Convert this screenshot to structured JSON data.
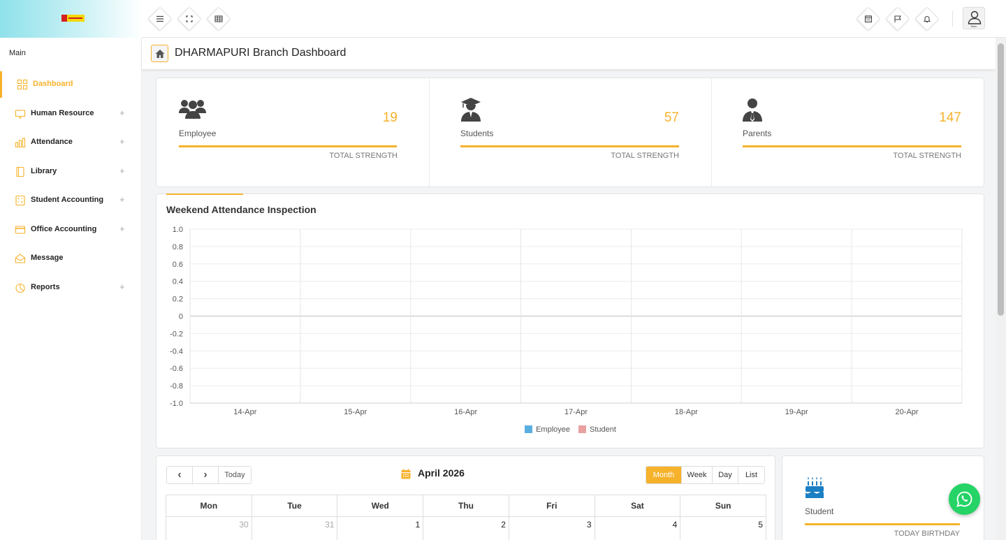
{
  "header": {
    "icons": [
      "menu-icon",
      "fullscreen-icon",
      "grid-icon",
      "calendar-icon",
      "flag-icon",
      "bell-icon",
      "user-icon"
    ],
    "avatar_caption": "Main"
  },
  "sidebar": {
    "section": "Main",
    "items": [
      {
        "label": "Dashboard",
        "icon": "dashboard-icon",
        "expandable": false,
        "active": true
      },
      {
        "label": "Human Resource",
        "icon": "monitor-icon",
        "expandable": true
      },
      {
        "label": "Attendance",
        "icon": "bar-chart-icon",
        "expandable": true
      },
      {
        "label": "Library",
        "icon": "book-icon",
        "expandable": true
      },
      {
        "label": "Student Accounting",
        "icon": "calculator-icon",
        "expandable": true
      },
      {
        "label": "Office Accounting",
        "icon": "credit-card-icon",
        "expandable": true
      },
      {
        "label": "Message",
        "icon": "envelope-icon",
        "expandable": false
      },
      {
        "label": "Reports",
        "icon": "pie-icon",
        "expandable": true
      }
    ],
    "expand_symbol": "+"
  },
  "page": {
    "title": "DHARMAPURI Branch Dashboard"
  },
  "stats": [
    {
      "label": "Employee",
      "value": "19",
      "footer": "TOTAL STRENGTH",
      "icon": "users-icon"
    },
    {
      "label": "Students",
      "value": "57",
      "footer": "TOTAL STRENGTH",
      "icon": "graduate-icon"
    },
    {
      "label": "Parents",
      "value": "147",
      "footer": "TOTAL STRENGTH",
      "icon": "user-tie-icon"
    }
  ],
  "chart_data": {
    "type": "bar",
    "title": "Weekend Attendance Inspection",
    "categories": [
      "14-Apr",
      "15-Apr",
      "16-Apr",
      "17-Apr",
      "18-Apr",
      "19-Apr",
      "20-Apr"
    ],
    "series": [
      {
        "name": "Employee",
        "values": [
          0,
          0,
          0,
          0,
          0,
          0,
          0
        ],
        "color": "#5aaee0"
      },
      {
        "name": "Student",
        "values": [
          0,
          0,
          0,
          0,
          0,
          0,
          0
        ],
        "color": "#e8a0a0"
      }
    ],
    "ylim": [
      -1.0,
      1.0
    ],
    "yticks": [
      "1.0",
      "0.8",
      "0.6",
      "0.4",
      "0.2",
      "0",
      "-0.2",
      "-0.4",
      "-0.6",
      "-0.8",
      "-1.0"
    ],
    "grid": true,
    "legend": "bottom"
  },
  "calendar": {
    "prev": "‹",
    "next": "›",
    "today": "Today",
    "title": "April 2026",
    "views": [
      "Month",
      "Week",
      "Day",
      "List"
    ],
    "active_view": "Month",
    "weekdays": [
      "Mon",
      "Tue",
      "Wed",
      "Thu",
      "Fri",
      "Sat",
      "Sun"
    ],
    "first_row": [
      {
        "day": "30",
        "muted": true
      },
      {
        "day": "31",
        "muted": true
      },
      {
        "day": "1",
        "muted": false
      },
      {
        "day": "2",
        "muted": false
      },
      {
        "day": "3",
        "muted": false
      },
      {
        "day": "4",
        "muted": false
      },
      {
        "day": "5",
        "muted": false
      }
    ]
  },
  "birthday": {
    "label": "Student",
    "footer": "TODAY BIRTHDAY",
    "icon": "birthday-cake-icon"
  },
  "whatsapp": {
    "icon": "whatsapp-icon"
  },
  "colors": {
    "accent": "#f6b22b",
    "whatsapp": "#25d366"
  }
}
